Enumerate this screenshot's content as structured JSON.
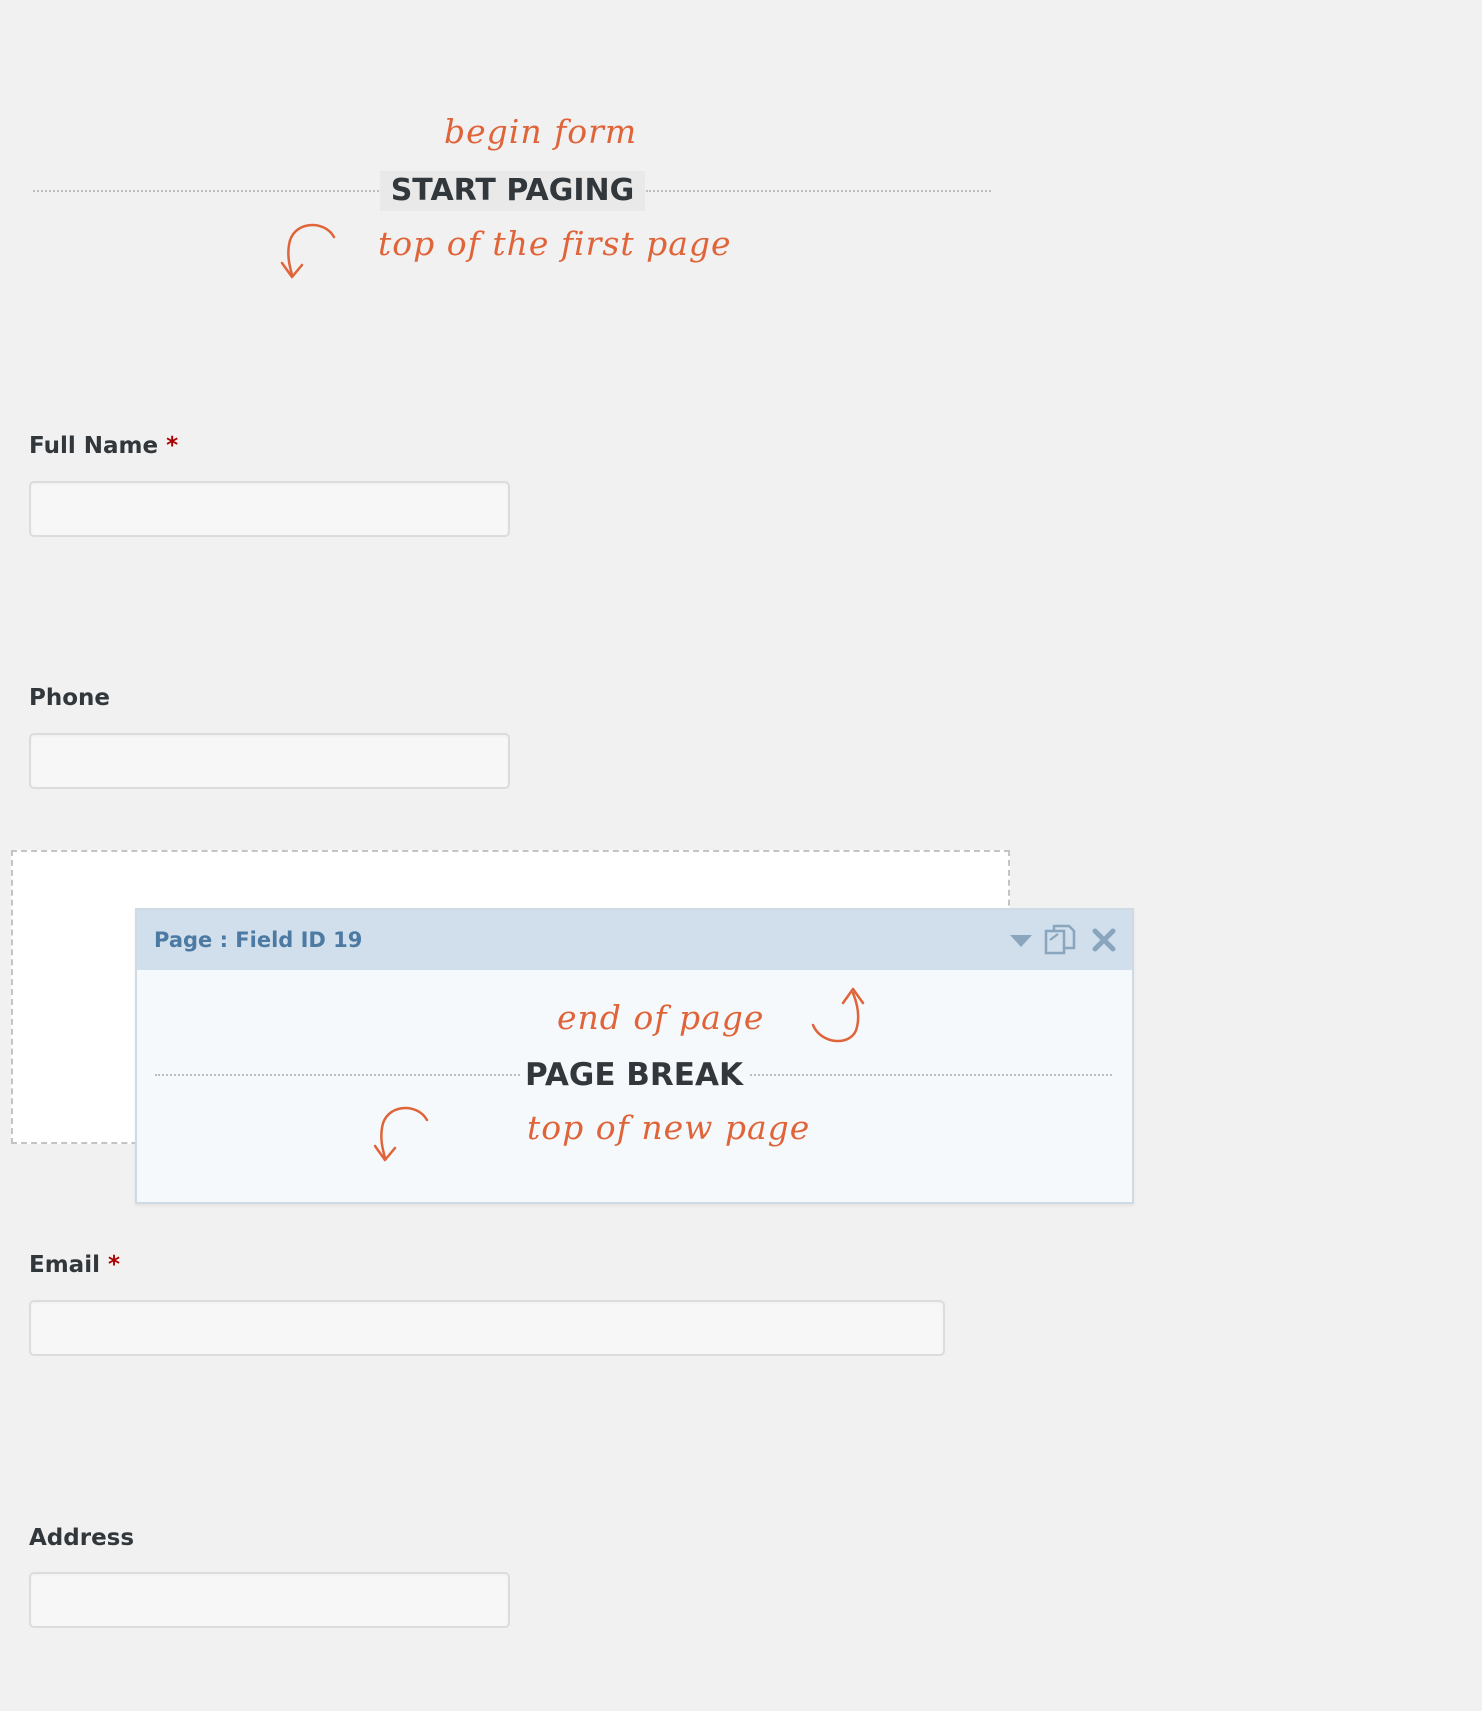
{
  "start_paging": {
    "annotation_above": "begin form",
    "title": "START PAGING",
    "annotation_below": "top of the first page"
  },
  "fields": {
    "full_name": {
      "label": "Full Name",
      "required_mark": "*",
      "value": ""
    },
    "phone": {
      "label": "Phone",
      "value": ""
    },
    "email": {
      "label": "Email",
      "required_mark": "*",
      "value": ""
    },
    "address": {
      "label": "Address",
      "value": ""
    }
  },
  "page_break_panel": {
    "header": "Page : Field ID 19",
    "annotation_above": "end of page",
    "title": "PAGE BREAK",
    "annotation_below": "top of new page",
    "icons": [
      "caret-down-icon",
      "duplicate-icon",
      "close-icon"
    ]
  },
  "colors": {
    "background": "#f1f1f1",
    "annotation": "#e0643a",
    "panel_header": "#d0dfeb",
    "panel_title": "#4c7aa3",
    "required": "#aa0000"
  }
}
